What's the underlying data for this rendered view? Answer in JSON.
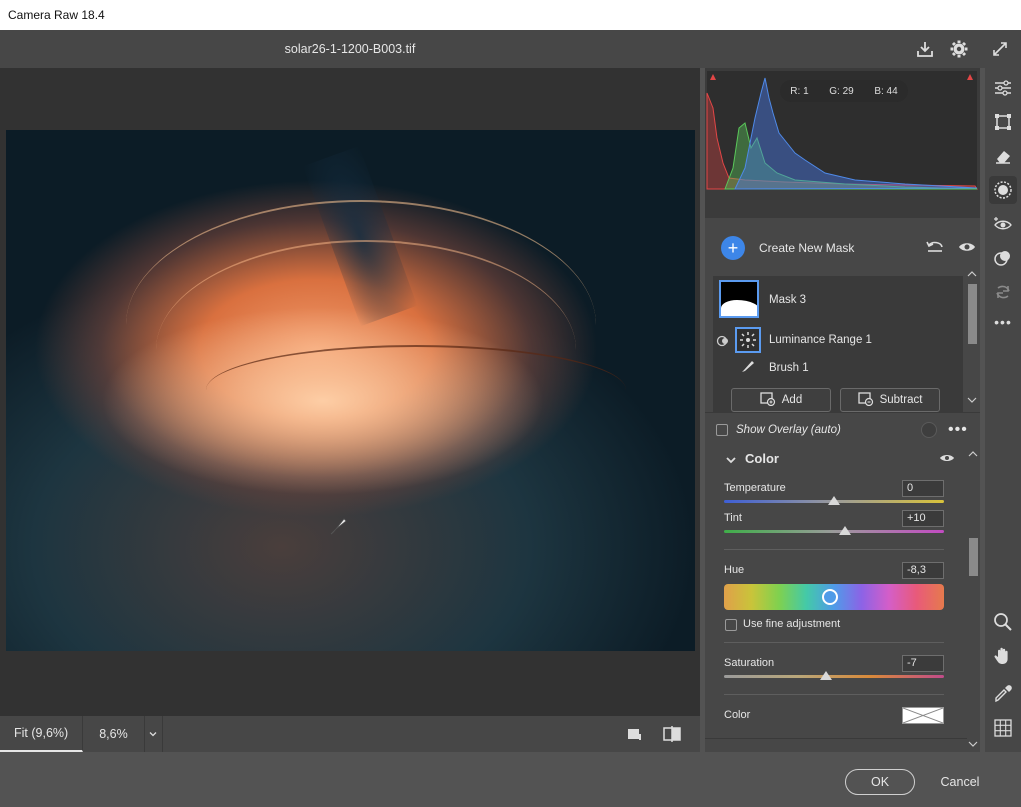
{
  "window": {
    "title": "Camera Raw 18.4"
  },
  "header": {
    "filename": "solar26-1-1200-B003.tif"
  },
  "icons": {
    "save": "save-download-icon",
    "settings": "gear-icon",
    "fullscreen": "expand-icon"
  },
  "histogram": {
    "r_label": "R: 1",
    "g_label": "G: 29",
    "b_label": "B: 44"
  },
  "masks": {
    "create_label": "Create New Mask",
    "items": [
      {
        "label": "Mask 3"
      },
      {
        "label": "Luminance Range 1"
      },
      {
        "label": "Brush 1"
      }
    ],
    "add_label": "Add",
    "subtract_label": "Subtract",
    "show_overlay_label": "Show Overlay (auto)"
  },
  "color_section": {
    "title": "Color",
    "temperature": {
      "label": "Temperature",
      "value": "0",
      "level": 0.5
    },
    "tint": {
      "label": "Tint",
      "value": "+10",
      "level": 0.55
    },
    "hue": {
      "label": "Hue",
      "value": "-8,3",
      "level": 0.48
    },
    "fine_adjust_label": "Use fine adjustment",
    "saturation": {
      "label": "Saturation",
      "value": "-7",
      "level": 0.465
    },
    "color_label": "Color"
  },
  "bottom": {
    "zoom_fit": "Fit (9,6%)",
    "zoom_pct": "8,6%"
  },
  "footer": {
    "ok_label": "OK",
    "cancel_label": "Cancel"
  }
}
